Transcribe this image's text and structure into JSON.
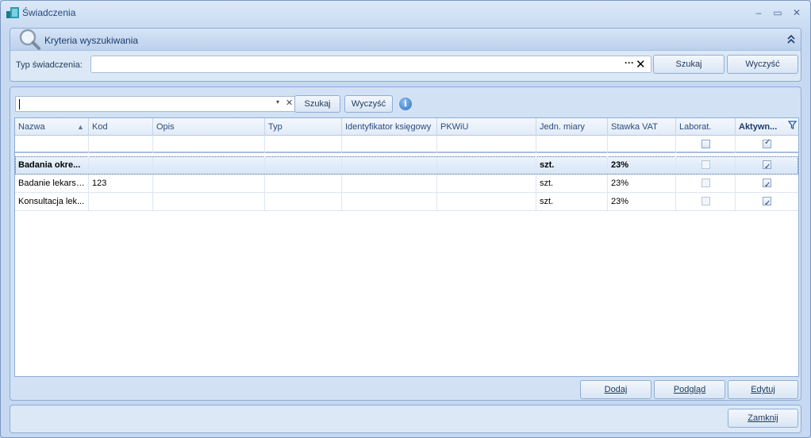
{
  "window": {
    "title": "Świadczenia",
    "minimize": "–",
    "maximize": "▭",
    "close": "✕"
  },
  "criteria": {
    "title": "Kryteria wyszukiwania",
    "collapse_glyph": "⌃",
    "type_label": "Typ świadczenia:",
    "type_value": "",
    "ellipsis": "···",
    "clear": "✕",
    "search_label": "Szukaj",
    "clear_label": "Wyczyść"
  },
  "grid_toolbar": {
    "filter_value": "",
    "dropdown_glyph": "▾",
    "clear_glyph": "✕",
    "search_label": "Szukaj",
    "clear_label": "Wyczyść",
    "info_glyph": "i"
  },
  "grid": {
    "columns": [
      "Nazwa",
      "Kod",
      "Opis",
      "Typ",
      "Identyfikator księgowy",
      "PKWiU",
      "Jedn. miary",
      "Stawka VAT",
      "Laborat.",
      "Aktywn..."
    ],
    "sort_glyph": "▲",
    "filter_glyph": "▼",
    "filter_row": {
      "laborat": false,
      "aktywny": true
    },
    "rows": [
      {
        "nazwa": "Badania okre...",
        "kod": "",
        "opis": "",
        "typ": "",
        "identyfikator": "",
        "pkwiu": "",
        "jedn": "szt.",
        "vat": "23%",
        "laborat": false,
        "aktywny": true,
        "selected": true,
        "bold": true
      },
      {
        "nazwa": "Badanie lekarski...",
        "kod": "123",
        "opis": "",
        "typ": "",
        "identyfikator": "",
        "pkwiu": "",
        "jedn": "szt.",
        "vat": "23%",
        "laborat": false,
        "aktywny": true,
        "selected": false,
        "bold": false
      },
      {
        "nazwa": "Konsultacja lek...",
        "kod": "",
        "opis": "",
        "typ": "",
        "identyfikator": "",
        "pkwiu": "",
        "jedn": "szt.",
        "vat": "23%",
        "laborat": false,
        "aktywny": true,
        "selected": false,
        "bold": false
      }
    ]
  },
  "actions": {
    "add": "Dodaj",
    "preview": "Podgląd",
    "edit": "Edytuj",
    "close": "Zamknij"
  },
  "colors": {
    "accent": "#1e3c6e",
    "panel": "#dce8f6",
    "border": "#8eacd6"
  }
}
